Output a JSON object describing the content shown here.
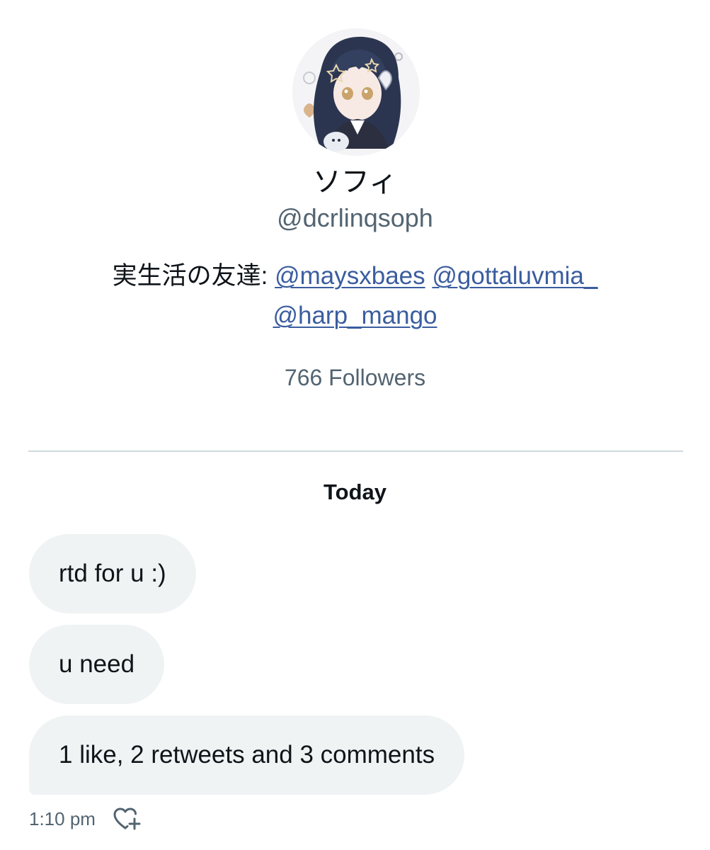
{
  "profile": {
    "display_name": "ソフィ",
    "handle": "@dcrlinqsoph",
    "bio": {
      "prefix": "実生活の友達: ",
      "mentions": [
        "@maysxbaes",
        "@gottaluvmia_",
        "@harp_mango"
      ]
    },
    "followers": "766 Followers",
    "avatar_icon": "anime-avatar-icon"
  },
  "conversation": {
    "date_separator": "Today",
    "messages": [
      {
        "text": "rtd for u :)"
      },
      {
        "text": "u need"
      },
      {
        "text": "1 like, 2 retweets and 3 comments"
      }
    ],
    "timestamp": "1:10 pm",
    "react_icon": "heart-plus-icon"
  },
  "colors": {
    "link": "#3b5d9f",
    "secondary_text": "#536471",
    "bubble_bg": "#eff3f4",
    "divider": "#cfd9de"
  }
}
